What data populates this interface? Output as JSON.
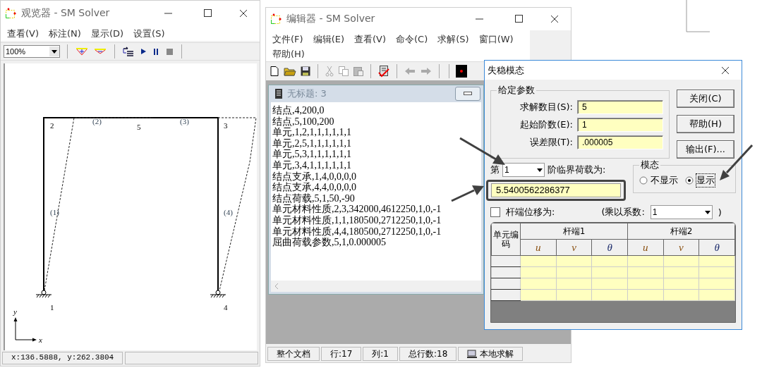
{
  "viewer": {
    "title": "观览器 - SM Solver",
    "menu": [
      "查看(V)",
      "标注(N)",
      "显示(D)",
      "设置(S)"
    ],
    "zoom": "100%",
    "diagram": {
      "node_labels": [
        "2",
        "5",
        "3",
        "1",
        "4"
      ],
      "element_labels": [
        "(2)",
        "(3)",
        "(1)",
        "(4)"
      ],
      "axis_labels": [
        "y",
        "x"
      ]
    },
    "status": [
      "x:136.5888, y:262.3804"
    ]
  },
  "editor": {
    "title": "编辑器 - SM Solver",
    "menu": [
      "文件(F)",
      "编辑(E)",
      "查看(V)",
      "命令(C)",
      "求解(S)",
      "窗口(W)",
      "帮助(H)"
    ],
    "document": {
      "title": "无标题: 3",
      "lines": [
        "结点,4,200,0",
        "结点,5,100,200",
        "单元,1,2,1,1,1,1,1,1",
        "单元,2,5,1,1,1,1,1,1",
        "单元,5,3,1,1,1,1,1,1",
        "单元,3,4,1,1,1,1,1,1",
        "结点支承,1,4,0,0,0,0",
        "结点支承,4,4,0,0,0,0",
        "结点荷载,5,1,50,-90",
        "单元材料性质,2,3,342000,4612250,1,0,-1",
        "单元材料性质,1,1,180500,2712250,1,0,-1",
        "单元材料性质,4,4,180500,2712250,1,0,-1",
        "屈曲荷载参数,5,1,0.000005"
      ]
    },
    "status": [
      "整个文档",
      "行:17",
      "列:1",
      "总行数:18",
      "本地求解"
    ]
  },
  "dialog": {
    "title": "失稳模态",
    "group_title": "给定参数",
    "fields": [
      {
        "label": "求解数目(S):",
        "value": "5"
      },
      {
        "label": "起始阶数(E):",
        "value": "1"
      },
      {
        "label": "误差限(T):",
        "value": ".000005"
      }
    ],
    "buttons": [
      "关闭(C)",
      "帮助(H)",
      "输出(F)..."
    ],
    "order_prefix": "第",
    "order_value": "1",
    "order_suffix": "阶临界荷载为:",
    "critical_load": "5.5400562286377",
    "mode": {
      "title": "模态",
      "options": [
        {
          "label": "不显示",
          "selected": false
        },
        {
          "label": "显示",
          "selected": true
        }
      ]
    },
    "displacement": {
      "label": "杆端位移为:",
      "checked": false,
      "factor_label": "(乘以系数:",
      "factor": "1",
      "close": ")"
    },
    "table": {
      "corner": "单元编码",
      "groups": [
        "杆端1",
        "杆端2"
      ],
      "columns": [
        "u",
        "v",
        "θ",
        "u",
        "v",
        "θ"
      ]
    }
  }
}
